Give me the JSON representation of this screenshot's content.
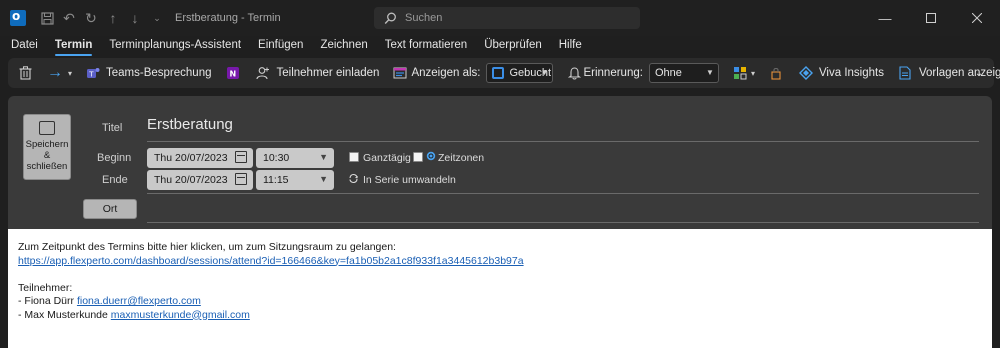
{
  "titlebar": {
    "window_title": "Erstberatung  -  Termin",
    "search_placeholder": "Suchen"
  },
  "menu": [
    "Datei",
    "Termin",
    "Terminplanungs-Assistent",
    "Einfügen",
    "Zeichnen",
    "Text formatieren",
    "Überprüfen",
    "Hilfe"
  ],
  "ribbon": {
    "teams_label": "Teams-Besprechung",
    "invite_label": "Teilnehmer einladen",
    "show_as_label": "Anzeigen als:",
    "show_as_value": "Gebucht",
    "reminder_label": "Erinnerung:",
    "reminder_value": "Ohne",
    "viva_label": "Viva Insights",
    "templates_label": "Vorlagen anzeigen",
    "more_label": "···"
  },
  "form": {
    "save_label_1": "Speichern",
    "save_label_2": "&",
    "save_label_3": "schließen",
    "title_label": "Titel",
    "title_value": "Erstberatung",
    "start_label": "Beginn",
    "start_date": "Thu 20/07/2023",
    "start_time": "10:30",
    "end_label": "Ende",
    "end_date": "Thu 20/07/2023",
    "end_time": "11:15",
    "allday_label": "Ganztägig",
    "timezones_label": "Zeitzonen",
    "recurring_label": "In Serie umwandeln",
    "location_button": "Ort"
  },
  "body": {
    "line1": "Zum Zeitpunkt des Termins bitte hier klicken, um zum Sitzungsraum zu gelangen:",
    "link": "https://app.flexperto.com/dashboard/sessions/attend?id=166466&key=fa1b05b2a1c8f933f1a3445612b3b97a",
    "participants_heading": "Teilnehmer:",
    "p1_name": "- Fiona Dürr ",
    "p1_email": "fiona.duerr@flexperto.com",
    "p2_name": "- Max Musterkunde ",
    "p2_email": "maxmusterkunde@gmail.com"
  },
  "colors": {
    "accent": "#4aa3f0",
    "link": "#1a5fb4",
    "form_bg": "#3a3a3a",
    "app_bg": "#1f1f1f"
  }
}
